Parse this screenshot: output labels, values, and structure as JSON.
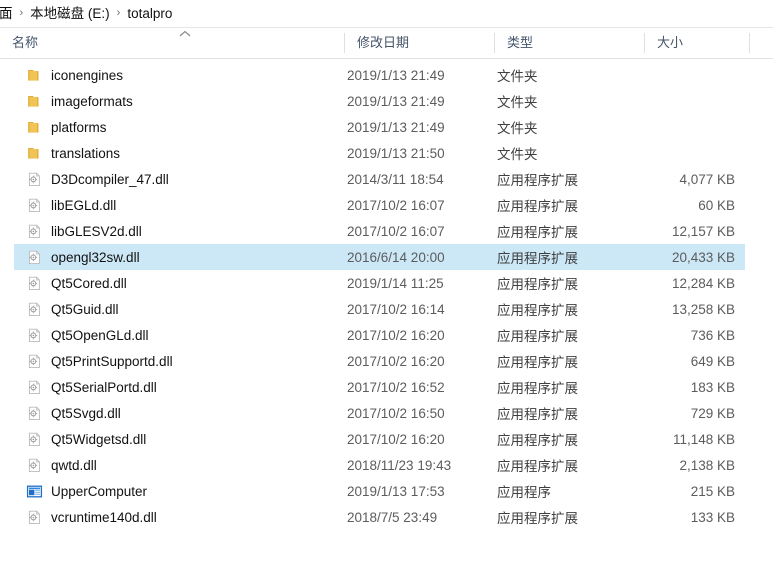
{
  "window": {
    "type": "file-explorer"
  },
  "breadcrumb": {
    "items": [
      {
        "label": "面",
        "clipped": true
      },
      {
        "label": "本地磁盘 (E:)",
        "clipped": false
      },
      {
        "label": "totalpro",
        "clipped": false
      }
    ],
    "separator": "›"
  },
  "columns": {
    "name": "名称",
    "date_modified": "修改日期",
    "type": "类型",
    "size": "大小",
    "sort_column": "名称",
    "sort_direction": "ascending",
    "sort_icon": "chevron-up-icon"
  },
  "colors": {
    "selection": "#cce8f7",
    "folder": "#ecbd52",
    "app_icon": "#1f6fc4",
    "header_text": "#44546a",
    "divider": "#e2e2e2"
  },
  "files": [
    {
      "name": "iconengines",
      "date": "2019/1/13 21:49",
      "type": "文件夹",
      "size": "",
      "icon": "folder-icon",
      "selected": false
    },
    {
      "name": "imageformats",
      "date": "2019/1/13 21:49",
      "type": "文件夹",
      "size": "",
      "icon": "folder-icon",
      "selected": false
    },
    {
      "name": "platforms",
      "date": "2019/1/13 21:49",
      "type": "文件夹",
      "size": "",
      "icon": "folder-icon",
      "selected": false
    },
    {
      "name": "translations",
      "date": "2019/1/13 21:50",
      "type": "文件夹",
      "size": "",
      "icon": "folder-icon",
      "selected": false
    },
    {
      "name": "D3Dcompiler_47.dll",
      "date": "2014/3/11 18:54",
      "type": "应用程序扩展",
      "size": "4,077 KB",
      "icon": "dll-file-icon",
      "selected": false
    },
    {
      "name": "libEGLd.dll",
      "date": "2017/10/2 16:07",
      "type": "应用程序扩展",
      "size": "60 KB",
      "icon": "dll-file-icon",
      "selected": false
    },
    {
      "name": "libGLESV2d.dll",
      "date": "2017/10/2 16:07",
      "type": "应用程序扩展",
      "size": "12,157 KB",
      "icon": "dll-file-icon",
      "selected": false
    },
    {
      "name": "opengl32sw.dll",
      "date": "2016/6/14 20:00",
      "type": "应用程序扩展",
      "size": "20,433 KB",
      "icon": "dll-file-icon",
      "selected": true
    },
    {
      "name": "Qt5Cored.dll",
      "date": "2019/1/14 11:25",
      "type": "应用程序扩展",
      "size": "12,284 KB",
      "icon": "dll-file-icon",
      "selected": false
    },
    {
      "name": "Qt5Guid.dll",
      "date": "2017/10/2 16:14",
      "type": "应用程序扩展",
      "size": "13,258 KB",
      "icon": "dll-file-icon",
      "selected": false
    },
    {
      "name": "Qt5OpenGLd.dll",
      "date": "2017/10/2 16:20",
      "type": "应用程序扩展",
      "size": "736 KB",
      "icon": "dll-file-icon",
      "selected": false
    },
    {
      "name": "Qt5PrintSupportd.dll",
      "date": "2017/10/2 16:20",
      "type": "应用程序扩展",
      "size": "649 KB",
      "icon": "dll-file-icon",
      "selected": false
    },
    {
      "name": "Qt5SerialPortd.dll",
      "date": "2017/10/2 16:52",
      "type": "应用程序扩展",
      "size": "183 KB",
      "icon": "dll-file-icon",
      "selected": false
    },
    {
      "name": "Qt5Svgd.dll",
      "date": "2017/10/2 16:50",
      "type": "应用程序扩展",
      "size": "729 KB",
      "icon": "dll-file-icon",
      "selected": false
    },
    {
      "name": "Qt5Widgetsd.dll",
      "date": "2017/10/2 16:20",
      "type": "应用程序扩展",
      "size": "11,148 KB",
      "icon": "dll-file-icon",
      "selected": false
    },
    {
      "name": "qwtd.dll",
      "date": "2018/11/23 19:43",
      "type": "应用程序扩展",
      "size": "2,138 KB",
      "icon": "dll-file-icon",
      "selected": false
    },
    {
      "name": "UpperComputer",
      "date": "2019/1/13 17:53",
      "type": "应用程序",
      "size": "215 KB",
      "icon": "application-icon",
      "selected": false
    },
    {
      "name": "vcruntime140d.dll",
      "date": "2018/7/5 23:49",
      "type": "应用程序扩展",
      "size": "133 KB",
      "icon": "dll-file-icon",
      "selected": false
    }
  ]
}
